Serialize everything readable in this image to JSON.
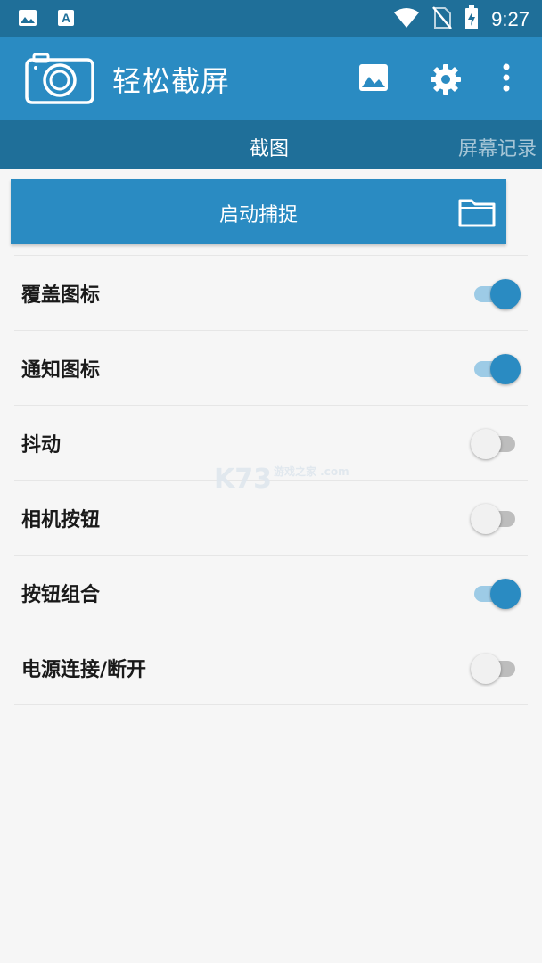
{
  "status_bar": {
    "time": "9:27",
    "icons_left": [
      "image-notification-icon",
      "text-a-notification-icon"
    ],
    "icons_right": [
      "wifi-icon",
      "no-sim-icon",
      "battery-charging-icon"
    ]
  },
  "app_bar": {
    "title": "轻松截屏",
    "actions": [
      "gallery-icon",
      "settings-icon",
      "more-vert-icon"
    ]
  },
  "tabs": [
    {
      "label": "截图",
      "active": true
    },
    {
      "label": "屏幕记录",
      "active": false
    }
  ],
  "capture": {
    "label": "启动捕捉",
    "icon": "folder-icon"
  },
  "settings": [
    {
      "label": "覆盖图标",
      "enabled": true
    },
    {
      "label": "通知图标",
      "enabled": true
    },
    {
      "label": "抖动",
      "enabled": false
    },
    {
      "label": "相机按钮",
      "enabled": false
    },
    {
      "label": "按钮组合",
      "enabled": true
    },
    {
      "label": "电源连接/断开",
      "enabled": false
    }
  ],
  "watermark": {
    "main": "K73",
    "sub": "游戏之家 .com"
  },
  "colors": {
    "app_bar": "#2a8bc2",
    "status_bar": "#1f6f99",
    "toggle_on": "#2a8bc2",
    "background": "#f6f6f6"
  }
}
